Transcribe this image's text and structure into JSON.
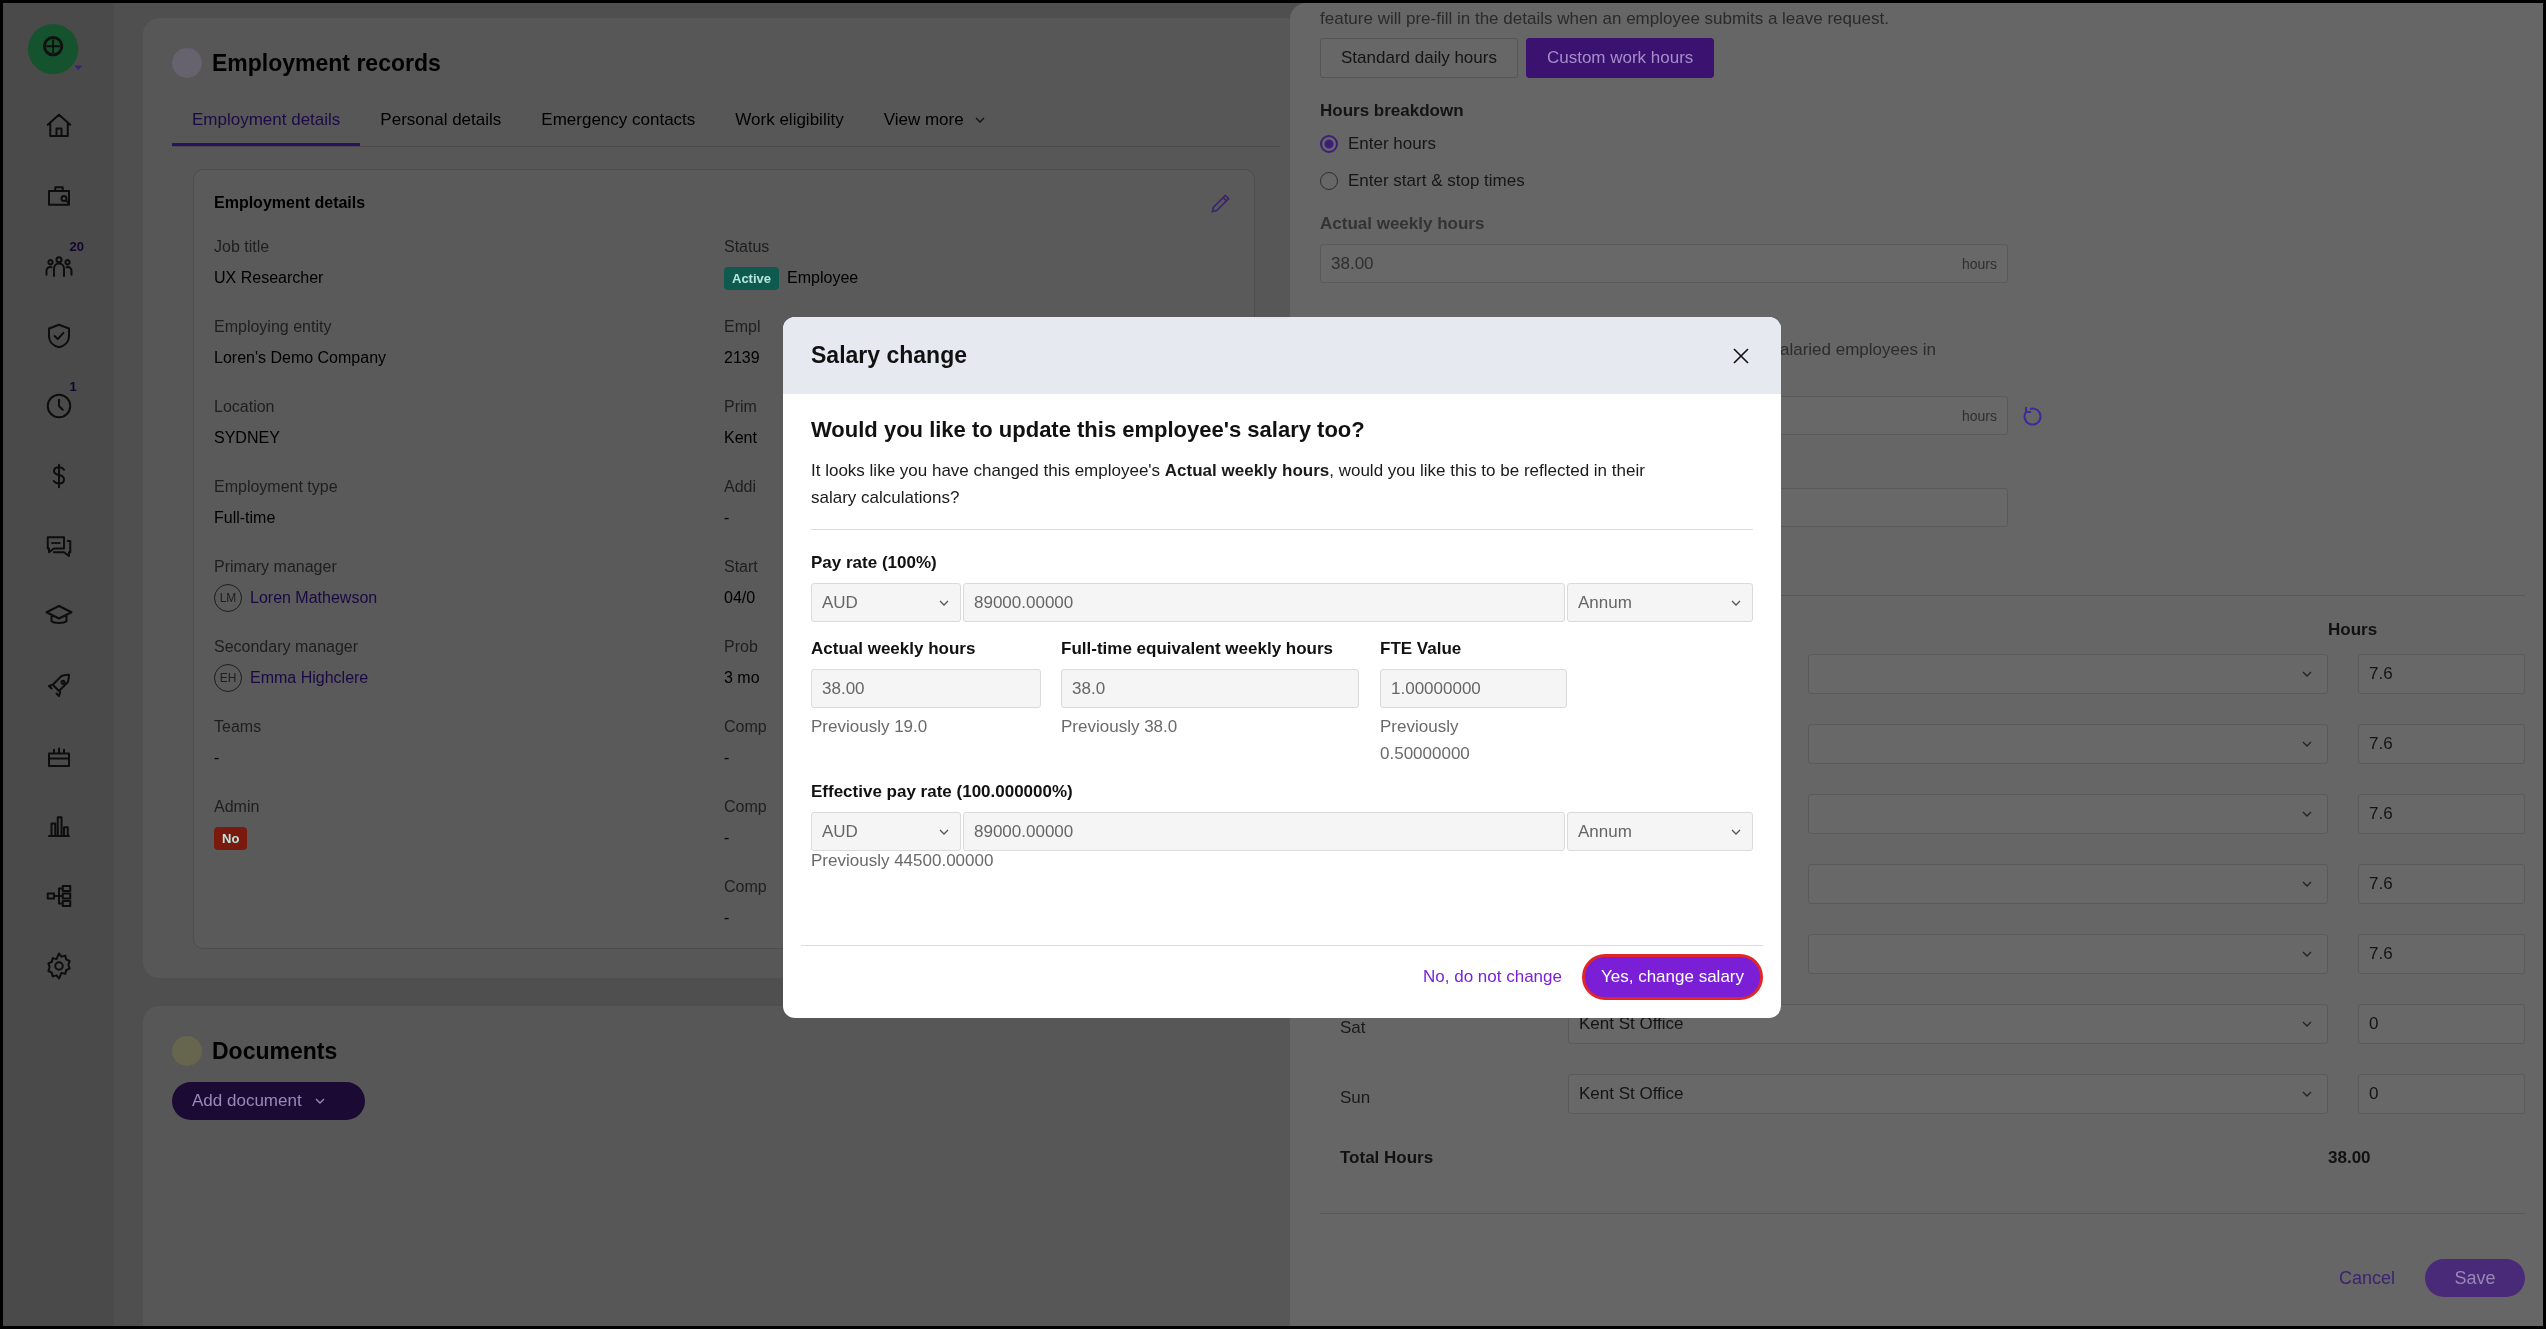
{
  "sidebar": {
    "items": [
      {
        "kind": "home"
      },
      {
        "kind": "briefcase"
      },
      {
        "kind": "people",
        "badge": "20"
      },
      {
        "kind": "shield"
      },
      {
        "kind": "clock",
        "badge": "1"
      },
      {
        "kind": "dollar"
      },
      {
        "kind": "chat"
      },
      {
        "kind": "graduation"
      },
      {
        "kind": "rocket"
      },
      {
        "kind": "cake"
      },
      {
        "kind": "chart"
      },
      {
        "kind": "org"
      },
      {
        "kind": "settings"
      }
    ]
  },
  "employment_records": {
    "title": "Employment records",
    "tabs": [
      {
        "label": "Employment details",
        "selected": true,
        "kind": "tab"
      },
      {
        "label": "Personal details",
        "selected": false,
        "kind": "tab"
      },
      {
        "label": "Emergency contacts",
        "selected": false,
        "kind": "tab"
      },
      {
        "label": "Work eligibility",
        "selected": false,
        "kind": "tab"
      },
      {
        "label": "View more",
        "selected": false,
        "kind": "menu"
      }
    ],
    "details": {
      "title": "Employment details",
      "left_fields": [
        {
          "label": "Job title",
          "kind": "text",
          "value": "UX Researcher"
        },
        {
          "label": "Employing entity",
          "kind": "text",
          "value": "Loren's Demo Company"
        },
        {
          "label": "Location",
          "kind": "text",
          "value": "SYDNEY"
        },
        {
          "label": "Employment type",
          "kind": "text",
          "value": "Full-time"
        },
        {
          "label": "Primary manager",
          "kind": "person",
          "initials": "LM",
          "value": "Loren Mathewson"
        },
        {
          "label": "Secondary manager",
          "kind": "person",
          "initials": "EH",
          "value": "Emma Highclere"
        },
        {
          "label": "Teams",
          "kind": "text",
          "value": "-"
        },
        {
          "label": "Admin",
          "kind": "badge",
          "badge": "No",
          "color": "#7a1a0e"
        }
      ],
      "right_fields": [
        {
          "label": "Status",
          "kind": "badge",
          "badge": "Active",
          "color": "#0e5a4f",
          "value": "Employee"
        },
        {
          "label": "Empl",
          "kind": "text",
          "value": "2139"
        },
        {
          "label": "Prim",
          "kind": "text",
          "value": "Kent"
        },
        {
          "label": "Addi",
          "kind": "text",
          "value": "-"
        },
        {
          "label": "Start",
          "kind": "text",
          "value": "04/0"
        },
        {
          "label": "Prob",
          "kind": "text",
          "value": "3 mo"
        },
        {
          "label": "Comp",
          "kind": "text",
          "value": "-"
        },
        {
          "label": "Comp",
          "kind": "text",
          "value": "-"
        },
        {
          "label": "Comp",
          "kind": "text",
          "value": "-"
        }
      ]
    }
  },
  "documents": {
    "title": "Documents",
    "add_button": "Add document"
  },
  "drawer": {
    "intro": "feature will pre-fill in the details when an employee submits a leave request.",
    "hours_buttons": [
      {
        "label": "Standard daily hours",
        "selected": false
      },
      {
        "label": "Custom work hours",
        "selected": true
      }
    ],
    "hours_breakdown": {
      "label": "Hours breakdown",
      "options": [
        {
          "label": "Enter hours",
          "selected": true
        },
        {
          "label": "Enter start & stop times",
          "selected": false
        }
      ]
    },
    "actual_weekly_hours": {
      "label": "Actual weekly hours",
      "value": "38.00",
      "unit": "hours"
    },
    "fte_note": "alaried employees in",
    "fte_hours_unit": "hours",
    "hours_header": "Hours",
    "days": [
      {
        "hours": "7.6"
      },
      {
        "hours": "7.6"
      },
      {
        "hours": "7.6"
      },
      {
        "hours": "7.6"
      },
      {
        "hours": "7.6"
      },
      {
        "day": "Sat",
        "location": "Kent St Office",
        "hours": "0"
      },
      {
        "day": "Sun",
        "location": "Kent St Office",
        "hours": "0"
      }
    ],
    "total": {
      "label": "Total Hours",
      "value": "38.00"
    },
    "cancel": "Cancel",
    "save": "Save"
  },
  "modal": {
    "title": "Salary change",
    "question": "Would you like to update this employee's salary too?",
    "message": "It looks like you have changed this employee's **Actual weekly hours**, would you like this to be reflected in their salary calculations?",
    "pay_rate": {
      "label": "Pay rate (100%)",
      "currency": "AUD",
      "amount": "89000.00000",
      "period": "Annum"
    },
    "hours_fields": [
      {
        "label": "Actual weekly hours",
        "value": "38.00",
        "previous": "Previously 19.0"
      },
      {
        "label": "Full-time equivalent weekly hours",
        "value": "38.0",
        "previous": "Previously 38.0"
      },
      {
        "label": "FTE Value",
        "value": "1.00000000",
        "previous": "Previously 0.50000000"
      }
    ],
    "effective_pay_rate": {
      "label": "Effective pay rate (100.000000%)",
      "currency": "AUD",
      "amount": "89000.00000",
      "period": "Annum",
      "previous": "Previously 44500.00000"
    },
    "decline": "No, do not change",
    "confirm": "Yes, change salary"
  }
}
